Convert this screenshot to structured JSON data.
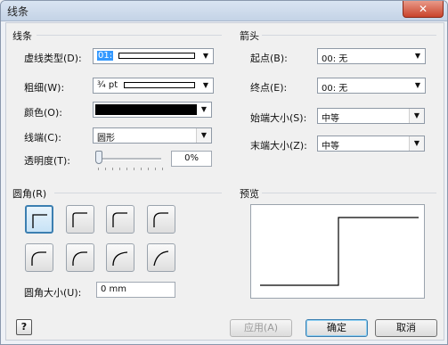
{
  "window": {
    "title": "线条",
    "close_label": "✕"
  },
  "line_group": {
    "title": "线条",
    "dash_type": {
      "label": "虚线类型(D):",
      "value": "01:"
    },
    "weight": {
      "label": "粗细(W):",
      "value": "¾ pt"
    },
    "color": {
      "label": "颜色(O):",
      "value": "#000000"
    },
    "cap": {
      "label": "线端(C):",
      "value": "圆形"
    },
    "transparency": {
      "label": "透明度(T):",
      "value": "0%",
      "level": 0
    }
  },
  "arrow_group": {
    "title": "箭头",
    "begin": {
      "label": "起点(B):",
      "value": "00: 无"
    },
    "end": {
      "label": "终点(E):",
      "value": "00: 无"
    },
    "begin_size": {
      "label": "始端大小(S):",
      "value": "中等"
    },
    "end_size": {
      "label": "末端大小(Z):",
      "value": "中等"
    }
  },
  "rounding_group": {
    "title": "圆角(R)",
    "size_label": "圆角大小(U):",
    "size_value": "0 mm",
    "selected_index": 0
  },
  "preview_group": {
    "title": "预览"
  },
  "buttons": {
    "help_icon": "?",
    "apply": "应用(A)",
    "ok": "确定",
    "cancel": "取消"
  }
}
